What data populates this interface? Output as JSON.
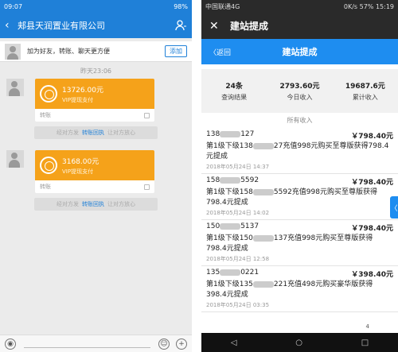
{
  "left": {
    "status": {
      "time": "09:07",
      "battery": "98%"
    },
    "header": {
      "back_icon": "chevron-left-icon",
      "title": "郏县天润置业有限公司",
      "profile_icon": "person-icon"
    },
    "add_friend": {
      "text": "加为好友，转账、聊天更方便",
      "button": "添加"
    },
    "timestamp": "昨天23:06",
    "messages": [
      {
        "amount": "13726.00元",
        "subtitle": "VIP提现支付",
        "footer": "转账"
      },
      {
        "amount": "3168.00元",
        "subtitle": "VIP提现支付",
        "footer": "转账"
      }
    ],
    "system_notices": [
      {
        "left": "经对方发",
        "link": "转账回执",
        "right": "让对方放心"
      },
      {
        "left": "经对方发",
        "link": "转账回执",
        "right": "让对方放心"
      }
    ],
    "bottom": {
      "voice_icon": "voice-icon",
      "emoji_icon": "emoji-icon",
      "plus_icon": "plus-icon"
    }
  },
  "right": {
    "status": {
      "carrier": "中国联通4G",
      "net": "0K/s",
      "battery": "57%",
      "time": "15:19"
    },
    "title_bar": {
      "close_icon": "close-icon",
      "title": "建站提成"
    },
    "nav": {
      "back": "〈返回",
      "title": "建站提成"
    },
    "stats": [
      {
        "value": "24条",
        "label": "查询结果"
      },
      {
        "value": "2793.60元",
        "label": "今日收入"
      },
      {
        "value": "19687.6元",
        "label": "累计收入"
      }
    ],
    "all_income": "所有收入",
    "records": [
      {
        "phone_a": "138",
        "phone_b": "127",
        "amount": "￥798.40元",
        "desc_a": "第1级下级138",
        "desc_b": "27充值998元购买至尊版获得798.4元提成",
        "time": "2018年05月24日 14:37"
      },
      {
        "phone_a": "158",
        "phone_b": "5592",
        "amount": "￥798.40元",
        "desc_a": "第1级下级158",
        "desc_b": "5592充值998元购买至尊版获得798.4元提成",
        "time": "2018年05月24日 14:02"
      },
      {
        "phone_a": "150",
        "phone_b": "5137",
        "amount": "￥798.40元",
        "desc_a": "第1级下级150",
        "desc_b": "137充值998元购买至尊版获得798.4元提成",
        "time": "2018年05月24日 12:58"
      },
      {
        "phone_a": "135",
        "phone_b": "0221",
        "amount": "￥398.40元",
        "desc_a": "第1级下级135",
        "desc_b": "221充值498元购买豪华版获得398.4元提成",
        "time": "2018年05月24日 03:35"
      }
    ],
    "side_tab": "〈",
    "page_hint": "4"
  }
}
